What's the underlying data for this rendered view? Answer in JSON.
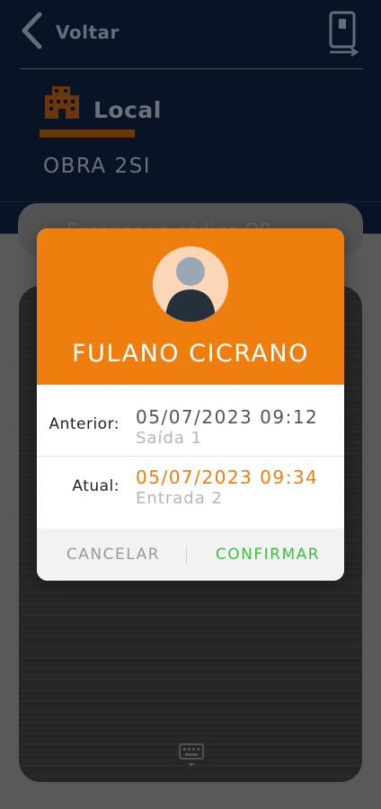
{
  "header": {
    "back_label": "Voltar",
    "section_title": "Local",
    "location_name": "OBRA 2SI"
  },
  "scan": {
    "prompt": "Escanear o código QR"
  },
  "dialog": {
    "user_name": "FULANO CICRANO",
    "previous": {
      "label": "Anterior:",
      "datetime": "05/07/2023 09:12",
      "event": "Saída 1"
    },
    "current": {
      "label": "Atual:",
      "datetime": "05/07/2023 09:34",
      "event": "Entrada 2"
    },
    "cancel_label": "CANCELAR",
    "confirm_label": "CONFIRMAR"
  },
  "icons": {
    "back": "chevron-left-icon",
    "device": "phone-transfer-icon",
    "building": "building-icon",
    "avatar": "user-avatar-icon",
    "keyboard": "keyboard-icon"
  },
  "colors": {
    "header_bg": "#0f2240",
    "accent_orange": "#ee7e0e",
    "confirm_green": "#3fbf3f",
    "current_time_orange": "#ee7e0e"
  }
}
